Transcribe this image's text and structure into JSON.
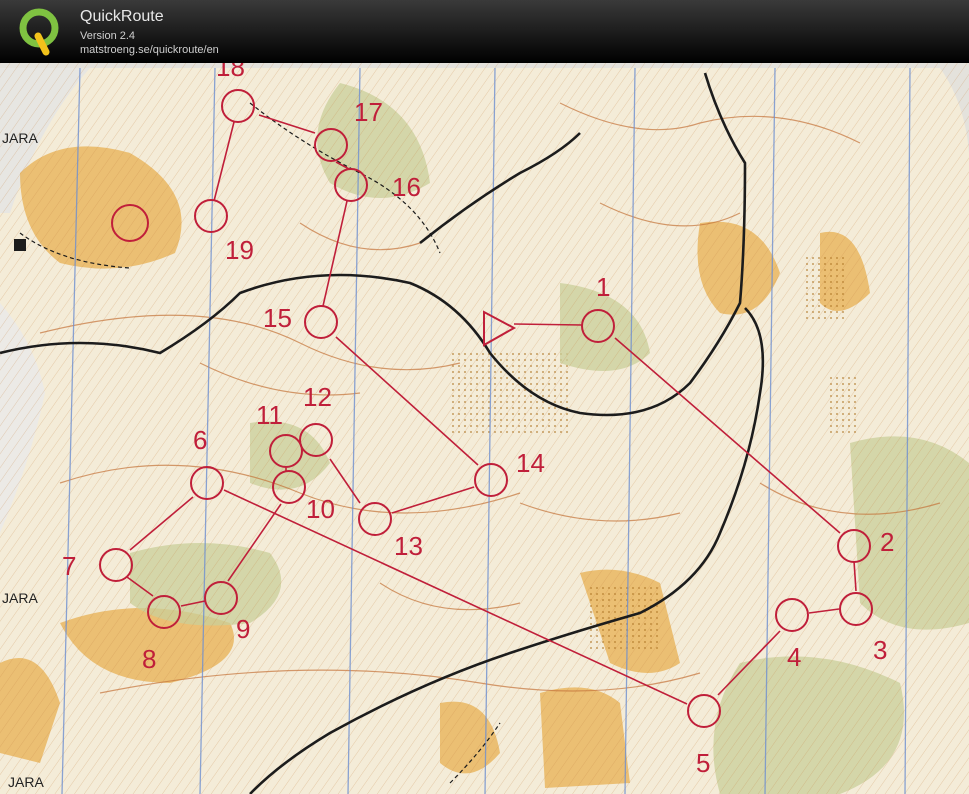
{
  "app": {
    "title": "QuickRoute",
    "version": "Version 2.4",
    "url": "matstroeng.se/quickroute/en"
  },
  "map": {
    "edge_labels": [
      "JARA",
      "JARA",
      "JARA"
    ],
    "controls": [
      {
        "label": "1"
      },
      {
        "label": "2"
      },
      {
        "label": "3"
      },
      {
        "label": "4"
      },
      {
        "label": "5"
      },
      {
        "label": "6"
      },
      {
        "label": "7"
      },
      {
        "label": "8"
      },
      {
        "label": "9"
      },
      {
        "label": "10"
      },
      {
        "label": "11"
      },
      {
        "label": "12"
      },
      {
        "label": "13"
      },
      {
        "label": "14"
      },
      {
        "label": "15"
      },
      {
        "label": "16"
      },
      {
        "label": "17"
      },
      {
        "label": "18"
      },
      {
        "label": "19"
      }
    ],
    "colors": {
      "course": "#c01f3a",
      "paper": "#f4ecd8",
      "open_land": "#e9b45a",
      "forest": "#c9cf9a",
      "north_lines": "#6e8fd0",
      "road": "#1c1c1c"
    }
  }
}
